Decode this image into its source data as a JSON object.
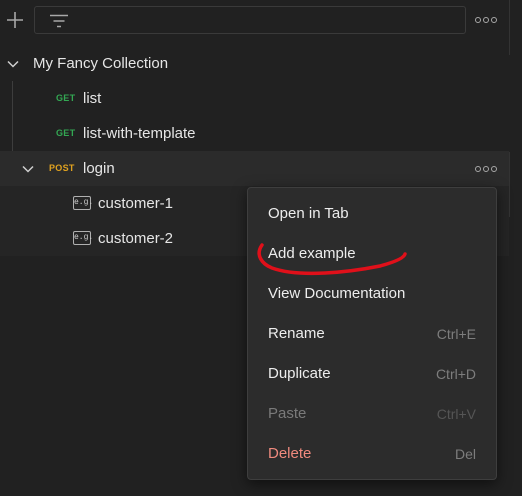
{
  "toolbar": {
    "add_icon": "plus-icon",
    "filter_icon": "filter-icon",
    "filter_placeholder": "",
    "more_icon": "more-options-icon"
  },
  "collection": {
    "name": "My Fancy Collection",
    "requests": [
      {
        "method": "GET",
        "name": "list"
      },
      {
        "method": "GET",
        "name": "list-with-template"
      },
      {
        "method": "POST",
        "name": "login",
        "expanded": true,
        "examples": [
          {
            "badge": "e.g.",
            "name": "customer-1"
          },
          {
            "badge": "e.g.",
            "name": "customer-2"
          }
        ]
      }
    ]
  },
  "context_menu": {
    "items": [
      {
        "label": "Open in Tab",
        "shortcut": ""
      },
      {
        "label": "Add example",
        "shortcut": ""
      },
      {
        "label": "View Documentation",
        "shortcut": ""
      },
      {
        "label": "Rename",
        "shortcut": "Ctrl+E"
      },
      {
        "label": "Duplicate",
        "shortcut": "Ctrl+D"
      },
      {
        "label": "Paste",
        "shortcut": "Ctrl+V",
        "disabled": true
      },
      {
        "label": "Delete",
        "shortcut": "Del",
        "danger": true
      }
    ]
  },
  "colors": {
    "background": "#212121",
    "get_method": "#33a853",
    "post_method": "#e0a21f",
    "delete": "#f08a7e",
    "annotation": "#e0101a"
  }
}
